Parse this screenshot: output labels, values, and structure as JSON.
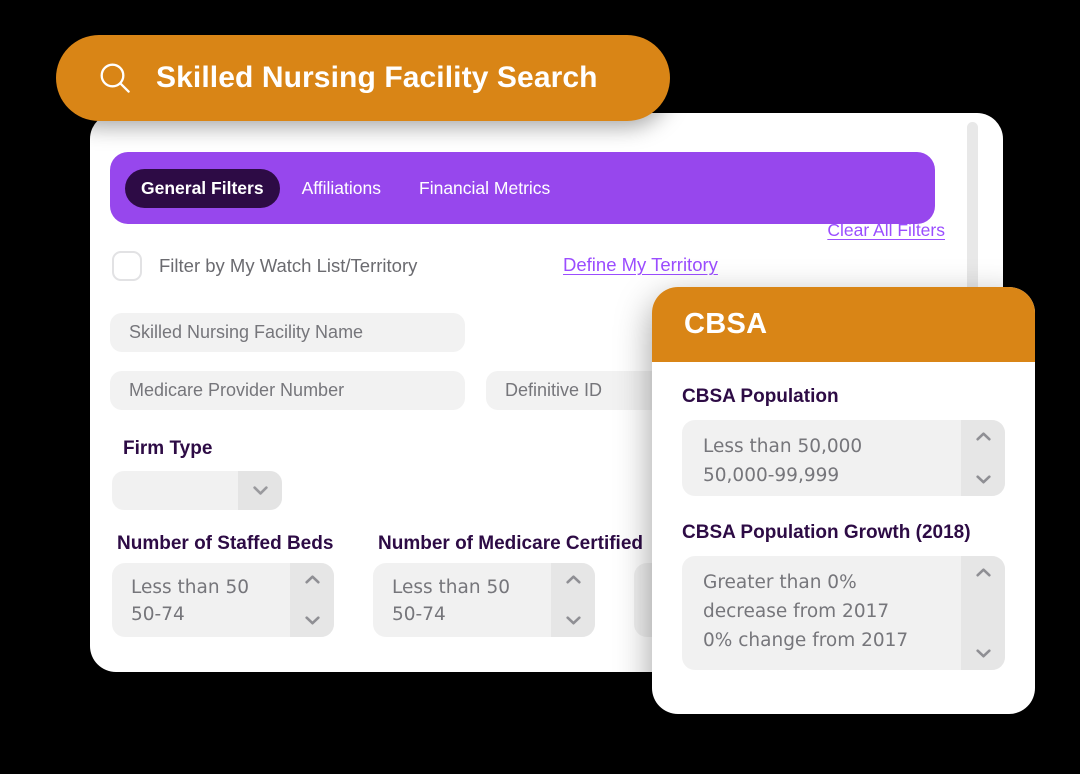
{
  "search_banner": {
    "icon": "search-icon",
    "title": "Skilled Nursing Facility Search"
  },
  "colors": {
    "brand_orange": "#d98516",
    "brand_purple": "#9747ed",
    "link_purple": "#9b4dff",
    "dark_purple": "#2d0b45",
    "field_gray": "#f1f1f1",
    "page_background": "#000000"
  },
  "toolbar": {
    "clear_all_label": "Clear All Filters"
  },
  "tabs": [
    {
      "label": "General Filters",
      "active": true
    },
    {
      "label": "Affiliations",
      "active": false
    },
    {
      "label": "Financial Metrics",
      "active": false
    }
  ],
  "watchlist": {
    "checkbox_label": "Filter by My Watch List/Territory",
    "checked": false,
    "territory_link_label": "Define My Territory"
  },
  "text_fields": [
    {
      "name": "facility-name",
      "value": "",
      "placeholder": "Skilled Nursing Facility Name"
    },
    {
      "name": "medicare-provider-number",
      "value": "",
      "placeholder": "Medicare Provider Number"
    },
    {
      "name": "definitive-id",
      "value": "",
      "placeholder": "Definitive ID"
    }
  ],
  "firm_type": {
    "label": "Firm Type",
    "selected": "",
    "arrow_icon": "chevron-down-icon"
  },
  "list_filters": [
    {
      "label": "Number of Staffed Beds",
      "options": [
        "Less than 50",
        "50-74"
      ],
      "up_icon": "chevron-up-icon",
      "down_icon": "chevron-down-icon"
    },
    {
      "label": "Number of Medicare Certified",
      "options": [
        "Less than 50",
        "50-74"
      ],
      "up_icon": "chevron-up-icon",
      "down_icon": "chevron-down-icon"
    }
  ],
  "cbsa_panel": {
    "title": "CBSA",
    "population": {
      "label": "CBSA Population",
      "options": [
        "Less than 50,000",
        "50,000-99,999"
      ],
      "up_icon": "chevron-up-icon",
      "down_icon": "chevron-down-icon"
    },
    "population_growth": {
      "label": "CBSA Population Growth (2018)",
      "options": [
        "Greater than 0% decrease from 2017",
        "0% change from 2017"
      ],
      "up_icon": "chevron-up-icon",
      "down_icon": "chevron-down-icon"
    }
  }
}
